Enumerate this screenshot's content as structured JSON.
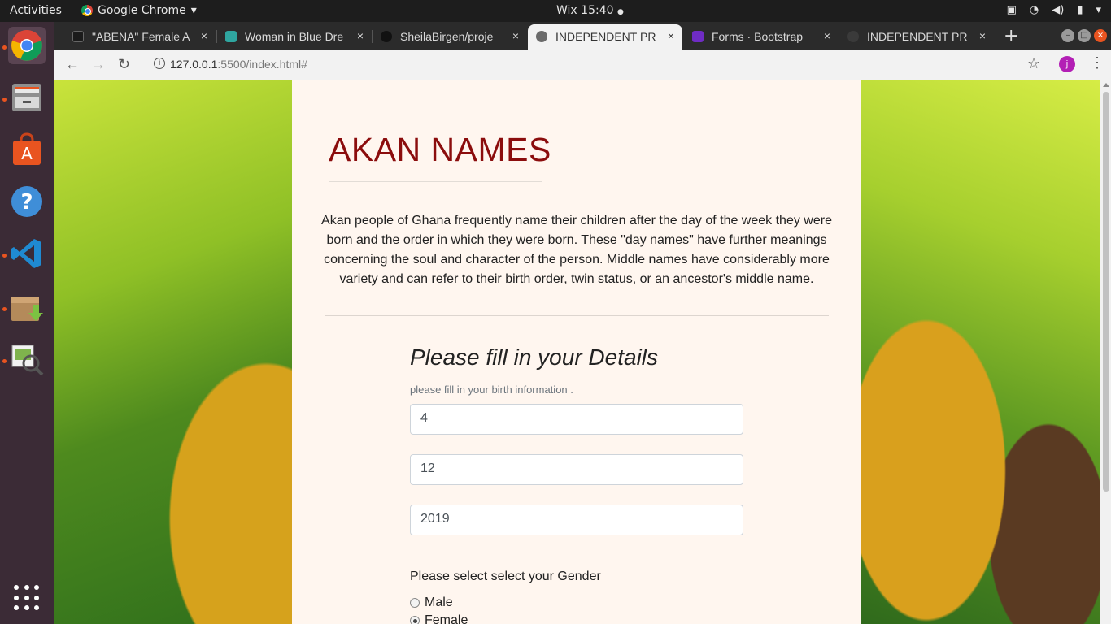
{
  "topbar": {
    "activities": "Activities",
    "app_name": "Google Chrome",
    "app_menu_arrow": "▾",
    "clock": "Wix 15:40",
    "clock_dot": "●"
  },
  "dock": {
    "items": [
      "chrome",
      "files",
      "software-center",
      "help",
      "vscode",
      "archive-manager",
      "image-viewer"
    ],
    "app_grid": "show-applications"
  },
  "tabs": [
    {
      "title": "\"ABENA\" Female A",
      "favicon_color": "#1b1b1b"
    },
    {
      "title": "Woman in Blue Dre",
      "favicon_color": "#2fa6a0"
    },
    {
      "title": "SheilaBirgen/proje",
      "favicon_color": "#111111"
    },
    {
      "title": "INDEPENDENT PR",
      "favicon_color": "#6a6a6a"
    },
    {
      "title": "Forms · Bootstrap",
      "favicon_color": "#6f2cc4"
    },
    {
      "title": "INDEPENDENT PR",
      "favicon_color": "#3a3a3a"
    }
  ],
  "tab_close_glyph": "×",
  "new_tab_glyph": "+",
  "toolbar": {
    "url_host": "127.0.0.1",
    "url_rest": ":5500/index.html#",
    "info_glyph": "i",
    "back_glyph": "←",
    "forward_glyph": "→",
    "reload_glyph": "↻",
    "star_glyph": "☆",
    "profile_initial": "j",
    "menu_glyph": "⋮"
  },
  "page": {
    "title": "AKAN NAMES",
    "intro": "Akan people of Ghana frequently name their children after the day of the week they were born and the order in which they were born. These \"day names\" have further meanings concerning the soul and character of the person. Middle names have considerably more variety and can refer to their birth order, twin status, or an ancestor's middle name.",
    "form_heading": "Please fill in your Details",
    "form_help": "please fill in your birth information .",
    "day_value": "4",
    "month_value": "12",
    "year_value": "2019",
    "gender_label": "Please select select your Gender",
    "gender_options": [
      "Male",
      "Female"
    ],
    "gender_selected": "Female"
  },
  "colors": {
    "title": "#8b0d0d",
    "content_bg": "#fff6ef",
    "profile": "#b31fb5",
    "ubuntu_accent": "#e95420"
  }
}
